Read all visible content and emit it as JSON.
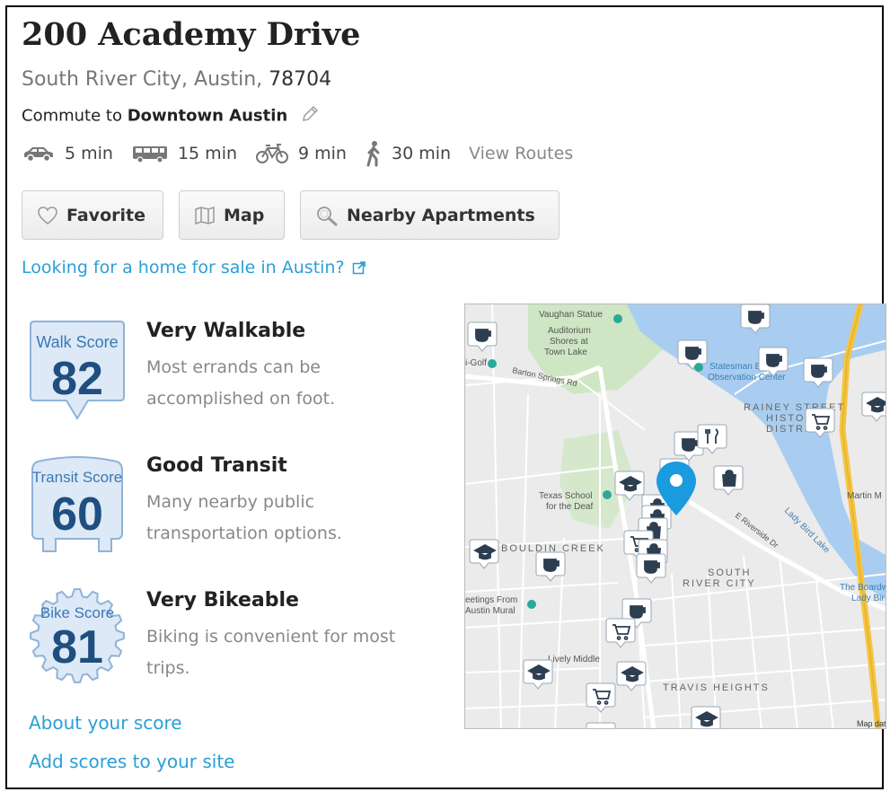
{
  "header": {
    "title": "200 Academy Drive",
    "neighborhood_city": "South River City, Austin,",
    "zip": "78704",
    "commute_prefix": "Commute to",
    "commute_destination": "Downtown Austin"
  },
  "commute_times": [
    {
      "mode": "car-icon",
      "label": "5 min"
    },
    {
      "mode": "bus-icon",
      "label": "15 min"
    },
    {
      "mode": "bike-icon",
      "label": "9 min"
    },
    {
      "mode": "walk-icon",
      "label": "30 min"
    }
  ],
  "view_routes_label": "View Routes",
  "buttons": {
    "favorite": "Favorite",
    "map": "Map",
    "nearby": "Nearby Apartments"
  },
  "home_sale_link": "Looking for a home for sale in Austin?",
  "scores": [
    {
      "type": "Walk Score",
      "value": "82",
      "heading": "Very Walkable",
      "line1": "Most errands can be",
      "line2": "accomplished on foot."
    },
    {
      "type": "Transit Score",
      "value": "60",
      "heading": "Good Transit",
      "line1": "Many nearby public",
      "line2": "transportation options."
    },
    {
      "type": "Bike Score",
      "value": "81",
      "heading": "Very Bikeable",
      "line1": "Biking is convenient for most",
      "line2": "trips."
    }
  ],
  "footer_links": {
    "about": "About your score",
    "add": "Add scores to your site"
  },
  "map": {
    "labels": {
      "vaughan": "Vaughan Statue",
      "auditorium": "Auditorium",
      "shores": "Shores at",
      "townlake": "Town Lake",
      "statesman": "Statesman Bat",
      "observation": "Observation Center",
      "rainey1": "RAINEY STREET",
      "rainey2": "HISTORIC",
      "rainey3": "DISTRICT",
      "texas_school1": "Texas School",
      "texas_school2": "for the Deaf",
      "bouldin": "BOULDIN CREEK",
      "south1": "SOUTH",
      "south2": "RIVER CITY",
      "travis": "TRAVIS HEIGHTS",
      "lady_bird": "Lady Bird Lake",
      "greetings1": "eetings From",
      "greetings2": "Austin Mural",
      "lively": "Lively Middle",
      "boardwalk1": "The Boardw",
      "boardwalk2": "Lady Bir",
      "martin": "Martin M",
      "golf": "i-Golf",
      "barton": "Barton Springs Rd",
      "riverside": "E Riverside Dr",
      "mapdata": "Map dat"
    },
    "accent": "#1a9be0",
    "marker_color": "#2d3e50"
  }
}
